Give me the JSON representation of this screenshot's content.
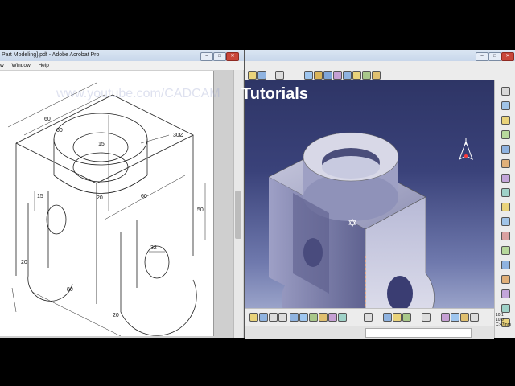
{
  "acrobat": {
    "title": "Part Modeling].pdf - Adobe Acrobat Pro",
    "menu": [
      "w",
      "Window",
      "Help"
    ],
    "drawing": {
      "dims": {
        "d60a": "60",
        "d60b": "60",
        "d15a": "15",
        "d30dia": "30Ø",
        "d15b": "15",
        "d20a": "20",
        "d60c": "60",
        "d50": "50",
        "d32": "32",
        "d20b": "20",
        "d80": "80",
        "d20c": "20"
      }
    }
  },
  "catia": {
    "watermark_ghost": "www.youtube.com/CADCAM",
    "watermark_text": "Tutorials",
    "status_coords": [
      "10.1",
      "10.0"
    ],
    "status_small": "C:47mm"
  }
}
